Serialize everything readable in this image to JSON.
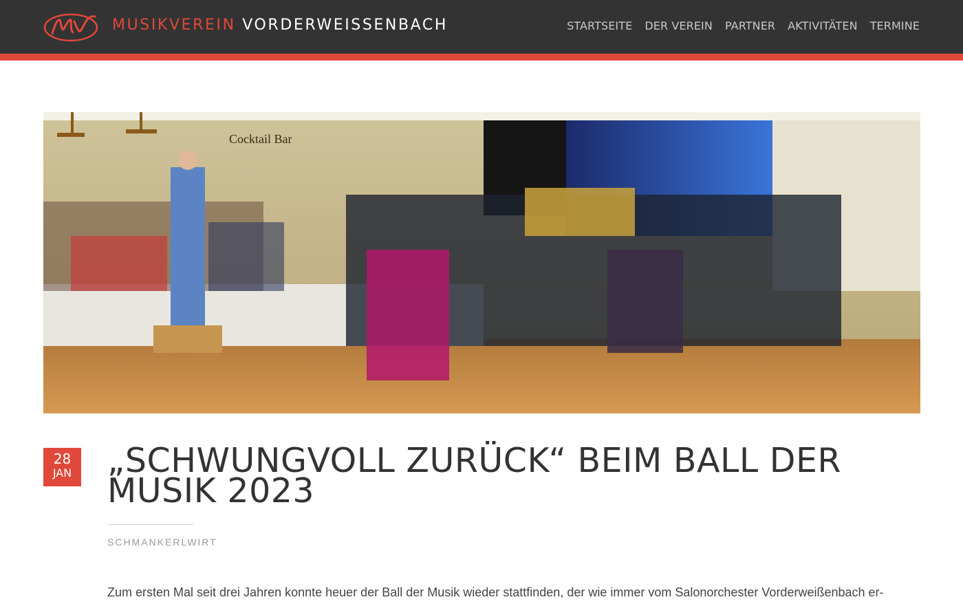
{
  "header": {
    "brand_first": "MUSIKVEREIN",
    "brand_second": "VORDERWEISSENBACH",
    "logo_text": "MV",
    "nav": [
      {
        "label": "STARTSEITE"
      },
      {
        "label": "DER VEREIN"
      },
      {
        "label": "PARTNER"
      },
      {
        "label": "AKTIVITÄTEN"
      },
      {
        "label": "TERMINE"
      }
    ]
  },
  "hero": {
    "sign_text": "Cocktail Bar"
  },
  "post": {
    "date_day": "28",
    "date_month": "JAN",
    "title": "„SCHWUNGVOLL ZURÜCK“ BEIM BALL DER MUSIK 2023",
    "category": "SCHMANKERLWIRT",
    "body": "Zum ersten Mal seit drei Jahren konnte heuer der Ball der Musik wieder stattfinden, der wie immer vom Salonorchester Vorderweißenbach er-"
  },
  "colors": {
    "header_bg": "#333333",
    "accent": "#e0483a",
    "nav_text": "#c8c8c8",
    "title_text": "#333333",
    "meta_text": "#999999"
  },
  "icons": {
    "logo": "mv-logo-icon"
  }
}
